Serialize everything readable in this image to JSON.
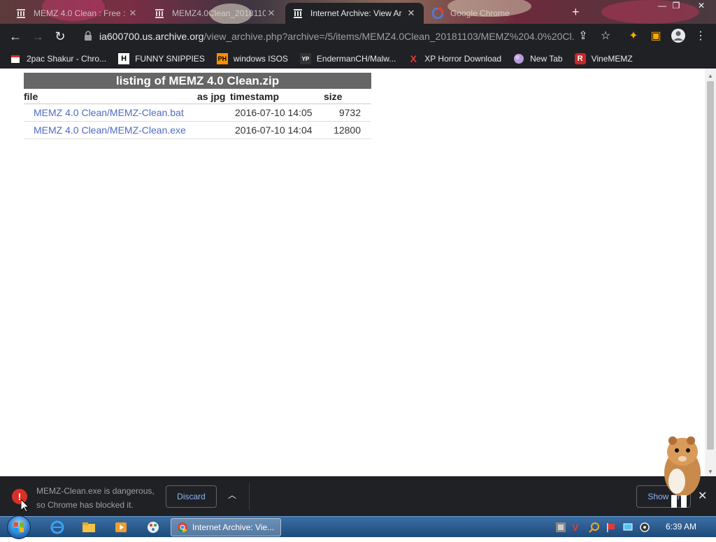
{
  "tabs": [
    {
      "title": "MEMZ 4.0 Clean : Free :",
      "active": false
    },
    {
      "title": "MEMZ4.0Clean_2018110",
      "active": false
    },
    {
      "title": "Internet Archive: View Ar",
      "active": true
    },
    {
      "title": "Google Chrome",
      "active": false
    }
  ],
  "toolbar": {
    "url_host": "ia600700.us.archive.org",
    "url_path": "/view_archive.php?archive=/5/items/MEMZ4.0Clean_20181103/MEMZ%204.0%20Cl..."
  },
  "bookmarks": [
    {
      "label": "2pac Shakur - Chro...",
      "icon": "calendar-icon",
      "color": "#d93025"
    },
    {
      "label": "FUNNY SNIPPIES",
      "icon": "H",
      "color": "#ffffff"
    },
    {
      "label": "windows ISOS",
      "icon": "PH",
      "color": "#ff9000"
    },
    {
      "label": "EndermanCH/Malw...",
      "icon": "YP",
      "color": "#333333"
    },
    {
      "label": "XP Horror Download",
      "icon": "X",
      "color": "#e53935"
    },
    {
      "label": "New Tab",
      "icon": "globe-icon",
      "color": "#9c27b0"
    },
    {
      "label": "VineMEMZ",
      "icon": "R",
      "color": "#c62828"
    }
  ],
  "listing": {
    "title": "listing of MEMZ 4.0 Clean.zip",
    "headers": {
      "file": "file",
      "asjpg": "as jpg",
      "timestamp": "timestamp",
      "size": "size"
    },
    "rows": [
      {
        "name": "MEMZ 4.0 Clean/MEMZ-Clean.bat",
        "timestamp": "2016-07-10 14:05",
        "size": "9732"
      },
      {
        "name": "MEMZ 4.0 Clean/MEMZ-Clean.exe",
        "timestamp": "2016-07-10 14:04",
        "size": "12800"
      }
    ]
  },
  "download": {
    "message_line1": "MEMZ-Clean.exe is dangerous,",
    "message_line2": "so Chrome has blocked it.",
    "discard_label": "Discard",
    "show_all_label": "Show all"
  },
  "taskbar": {
    "task_label": "Internet Archive: Vie...",
    "clock": "6:39 AM"
  },
  "colors": {
    "accent_link": "#4f6cc3",
    "chrome_dark": "#202124",
    "danger": "#d93025"
  }
}
